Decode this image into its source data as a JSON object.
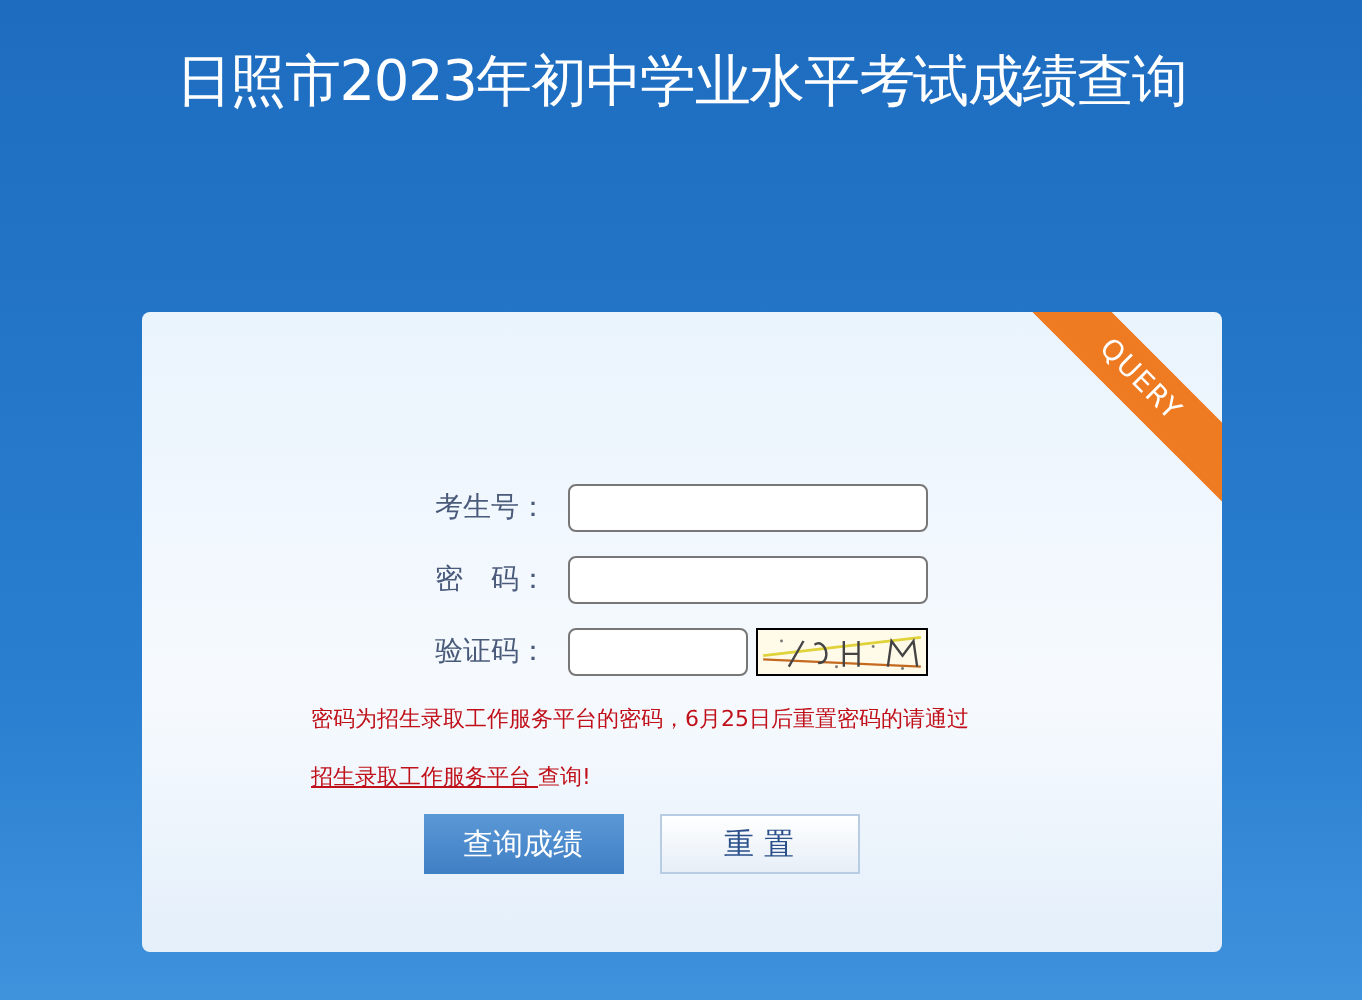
{
  "title": "日照市2023年初中学业水平考试成绩查询",
  "ribbon": "QUERY",
  "fields": [
    {
      "label": "考生号：",
      "kind": "text"
    },
    {
      "label": "密　码：",
      "kind": "password"
    },
    {
      "label": "验证码：",
      "kind": "captcha"
    }
  ],
  "notice": {
    "text": "密码为招生录取工作服务平台的密码，6月25日后重置密码的请通过",
    "link": "招生录取工作服务平台 ",
    "suffix": "查询!"
  },
  "buttons": [
    {
      "label": "查询成绩",
      "kind": "primary"
    },
    {
      "label": "重 置",
      "kind": "secondary"
    }
  ]
}
